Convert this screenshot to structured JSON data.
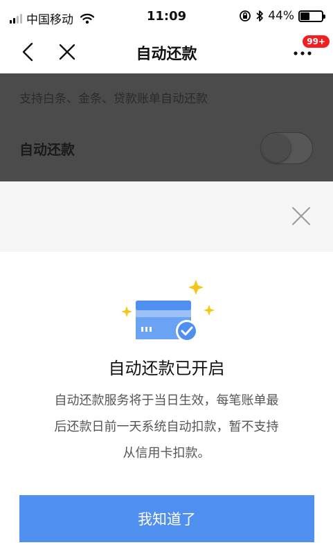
{
  "status_bar": {
    "carrier": "中国移动",
    "time": "11:09",
    "battery_percent": "44%",
    "battery_level": 0.44,
    "icons": [
      "signal-icon",
      "wifi-icon",
      "rotation-lock-icon",
      "bluetooth-icon",
      "battery-icon"
    ]
  },
  "nav": {
    "title": "自动还款",
    "badge": "99+",
    "icons": [
      "back-icon",
      "close-icon",
      "more-icon"
    ]
  },
  "background_page": {
    "description": "支持白条、金条、贷款账单自动还款",
    "auto_repay_label": "自动还款",
    "toggle_on": false
  },
  "sheet": {
    "title": "自动还款已开启",
    "message": "自动还款服务将于当日生效，每笔账单最后还款日前一天系统自动扣款，暂不支持从信用卡扣款。",
    "confirm_label": "我知道了",
    "icons": [
      "sheet-close-icon",
      "credit-card-check-icon",
      "sparkle-icon"
    ]
  },
  "colors": {
    "accent": "#4f8ff0",
    "badge": "#f01f22",
    "sparkle": "#f5c518",
    "card": "#4f8ff0"
  }
}
